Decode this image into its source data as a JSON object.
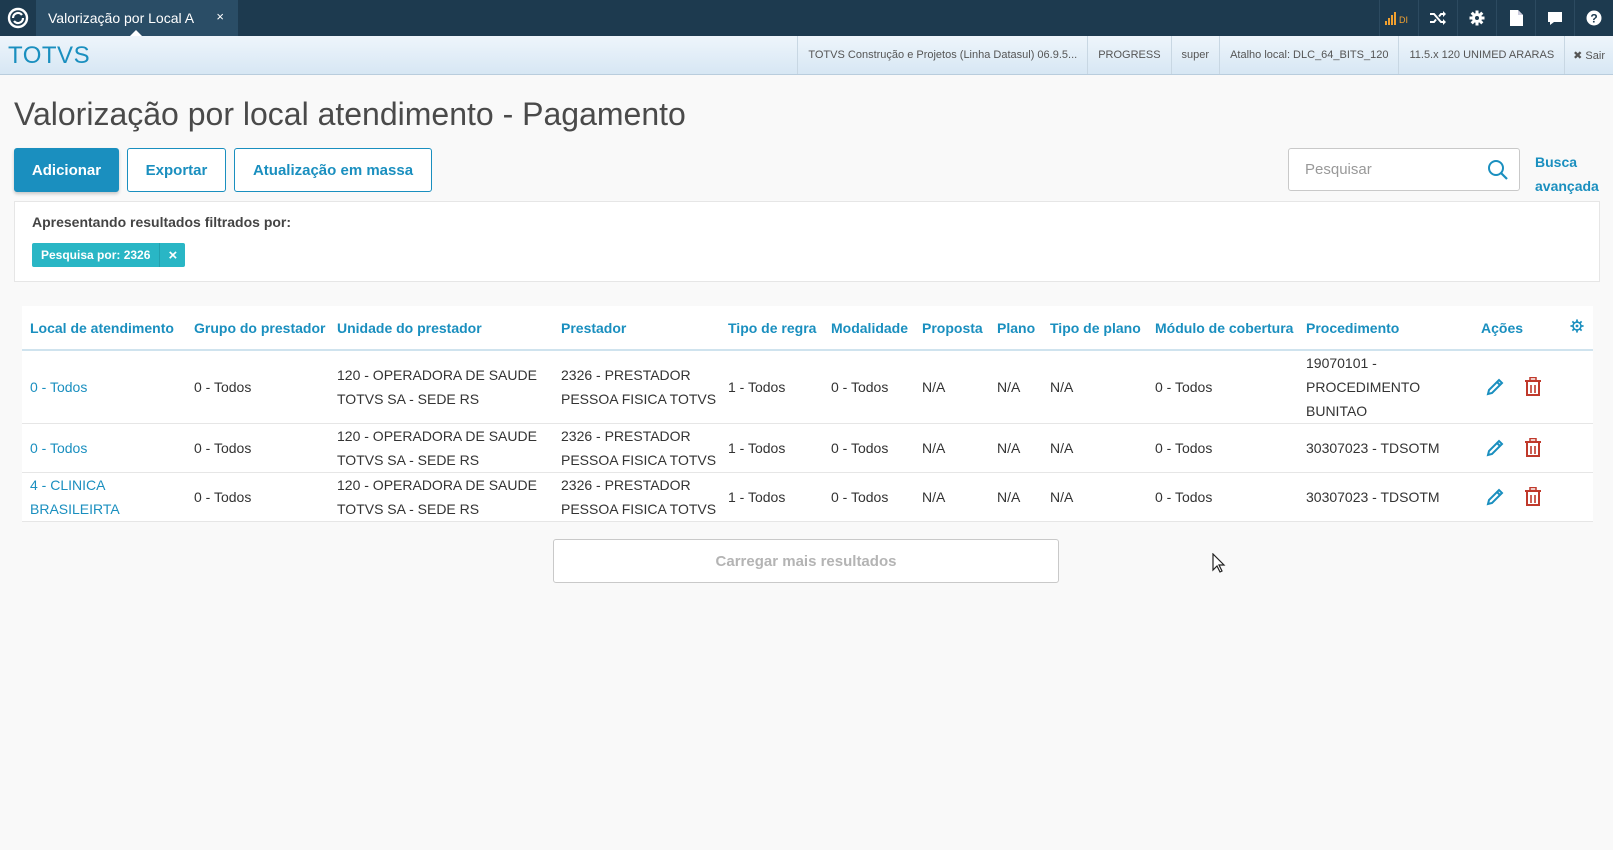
{
  "topbar": {
    "tab_label": "Valorização por Local A",
    "tab_close": "×",
    "signal_label": "DI",
    "icons": [
      "app-logo-icon",
      "signal-icon",
      "shuffle-icon",
      "gear-icon",
      "document-icon",
      "chat-icon",
      "help-icon"
    ]
  },
  "header": {
    "brand": "TOTVS",
    "info": [
      "TOTVS Construção e Projetos (Linha Datasul) 06.9.5...",
      "PROGRESS",
      "super",
      "Atalho local: DLC_64_BITS_120",
      "11.5.x 120 UNIMED ARARAS"
    ],
    "logout_label": "✖ Sair"
  },
  "page": {
    "title": "Valorização por local atendimento - Pagamento"
  },
  "toolbar": {
    "add_label": "Adicionar",
    "export_label": "Exportar",
    "bulk_update_label": "Atualização em massa",
    "search_placeholder": "Pesquisar",
    "advanced_search_line1": "Busca",
    "advanced_search_line2": "avançada"
  },
  "filter": {
    "title": "Apresentando resultados filtrados por:",
    "chip_label": "Pesquisa por: 2326",
    "chip_close": "×"
  },
  "table": {
    "columns": [
      "Local de atendimento",
      "Grupo do prestador",
      "Unidade do prestador",
      "Prestador",
      "Tipo de regra",
      "Modalidade",
      "Proposta",
      "Plano",
      "Tipo de plano",
      "Módulo de cobertura",
      "Procedimento",
      "Ações"
    ],
    "rows": [
      [
        "0 - Todos",
        "0 - Todos",
        "120 - OPERADORA DE SAUDE TOTVS SA - SEDE RS",
        "2326 - PRESTADOR PESSOA FISICA TOTVS",
        "1 - Todos",
        "0 - Todos",
        "N/A",
        "N/A",
        "N/A",
        "0 - Todos",
        "19070101 - PROCEDIMENTO BUNITAO"
      ],
      [
        "0 - Todos",
        "0 - Todos",
        "120 - OPERADORA DE SAUDE TOTVS SA - SEDE RS",
        "2326 - PRESTADOR PESSOA FISICA TOTVS",
        "1 - Todos",
        "0 - Todos",
        "N/A",
        "N/A",
        "N/A",
        "0 - Todos",
        "30307023 - TDSOTM"
      ],
      [
        "4 - CLINICA BRASILEIRTA",
        "0 - Todos",
        "120 - OPERADORA DE SAUDE TOTVS SA - SEDE RS",
        "2326 - PRESTADOR PESSOA FISICA TOTVS",
        "1 - Todos",
        "0 - Todos",
        "N/A",
        "N/A",
        "N/A",
        "0 - Todos",
        "30307023 - TDSOTM"
      ]
    ],
    "load_more_label": "Carregar mais resultados"
  },
  "colors": {
    "accent": "#1a8fbf",
    "topbar": "#1d3a4f",
    "chip": "#29b6c5",
    "delete": "#c0392b"
  }
}
